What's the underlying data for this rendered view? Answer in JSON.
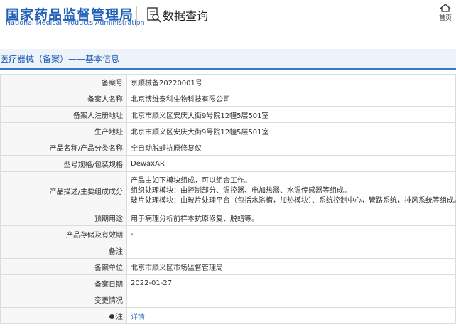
{
  "header": {
    "logo_cn": "国家药品监督管理局",
    "logo_en": "National Medical Products Administration",
    "query_title": "数据查询",
    "home_label": "首页"
  },
  "page_title": "医疗器械（备案）——基本信息",
  "rows": [
    {
      "label": "备案号",
      "value": "京顺械备20220001号"
    },
    {
      "label": "备案人名称",
      "value": "北京博维泰科生物科技有限公司"
    },
    {
      "label": "备案人注册地址",
      "value": "北京市顺义区安庆大街9号院12幢5层501室"
    },
    {
      "label": "生产地址",
      "value": "北京市顺义区安庆大街9号院12幢5层501室"
    },
    {
      "label": "产品名称/产品分类名称",
      "value": "全自动脱蜡抗原修复仪"
    },
    {
      "label": "型号规格/包装规格",
      "value": "DewaxAR"
    },
    {
      "label": "产品描述/主要组成成分",
      "lines": [
        "产品由如下模块组成，可以组合工作。",
        "组织处理模块：由控制部分、温控器、电加热器、水温传感器等组成。",
        "玻片处理模块：由玻片处理平台（包括水浴槽，加热模块）、系统控制中心，管路系统，排风系统等组成。"
      ]
    },
    {
      "label": "预期用途",
      "value": "用于病理分析前样本抗原修复、脱蜡等。"
    },
    {
      "label": "产品存储及有效期",
      "value": "-"
    },
    {
      "label": "备注",
      "value": ""
    },
    {
      "label": "备案单位",
      "value": "北京市顺义区市场监督管理局"
    },
    {
      "label": "备案日期",
      "value": "2022-01-27"
    },
    {
      "label": "变更情况",
      "value": ""
    },
    {
      "label": "注",
      "link": "详情"
    }
  ]
}
